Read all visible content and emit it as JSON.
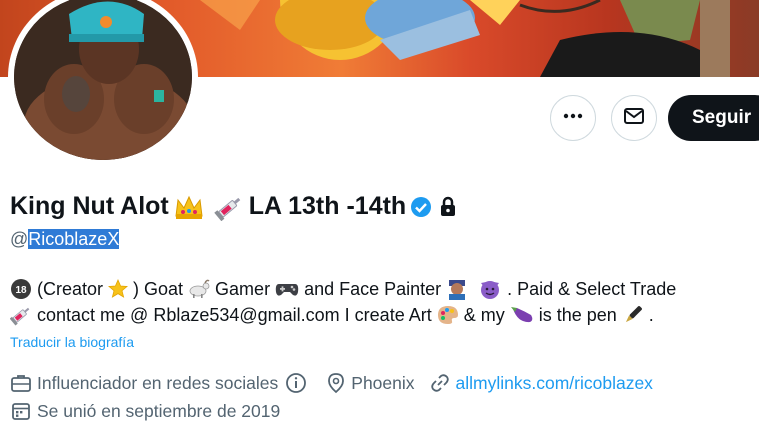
{
  "profile": {
    "display_name_part1": "King Nut Alot",
    "display_name_part2": "LA 13th -14th",
    "handle_prefix": "@",
    "handle": "RicoblazeX",
    "badges": [
      "crown-emoji",
      "syringe-emoji",
      "verified-badge-icon",
      "lock-icon"
    ]
  },
  "actions": {
    "more_icon": "more-horizontal-icon",
    "message_icon": "envelope-icon",
    "follow_label": "Seguir"
  },
  "bio": {
    "line1": {
      "seg1": "(Creator",
      "seg2": ") Goat",
      "seg3": "Gamer",
      "seg4": "and Face Painter",
      "seg5": ". Paid & Select Trade"
    },
    "line2": {
      "seg1": "contact me @ Rblaze534@gmail.com I create Art",
      "seg2": "& my",
      "seg3": "is the pen",
      "seg4": "."
    },
    "translate_label": "Traducir la biografía"
  },
  "meta": {
    "category": "Influenciador en redes sociales",
    "location": "Phoenix",
    "link": "allmylinks.com/ricoblazex",
    "joined": "Se unió en septiembre de 2019"
  },
  "colors": {
    "accent": "#1d9bf0",
    "follow_bg": "#0f1419",
    "selection": "#2f7bd6",
    "secondary_text": "#536471"
  }
}
